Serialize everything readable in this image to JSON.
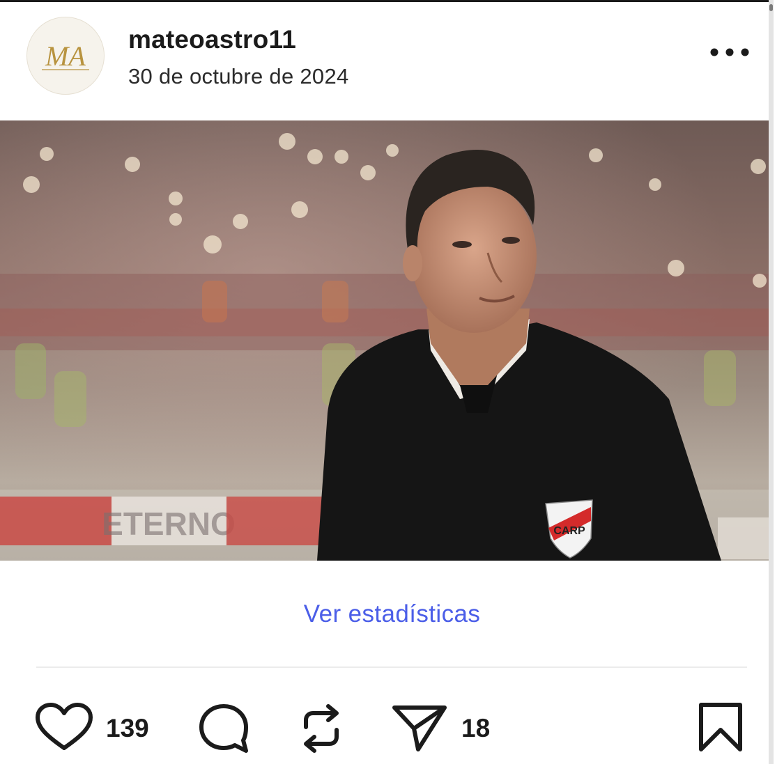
{
  "post": {
    "username": "mateoastro11",
    "date": "30 de octubre de 2024",
    "avatar_monogram": "MA",
    "more_icon": "more-horizontal-icon",
    "image": {
      "subject": "coach in black suit at stadium",
      "banner_text_1": "ETERNO"
    }
  },
  "stats_link": "Ver estadísticas",
  "actions": {
    "likes": "139",
    "shares": "18",
    "like_icon": "heart-icon",
    "comment_icon": "comment-icon",
    "repost_icon": "repost-icon",
    "share_icon": "send-icon",
    "save_icon": "bookmark-icon"
  },
  "colors": {
    "link": "#4b5ee8",
    "text": "#1b1b1b",
    "avatar_gold": "#b8933f"
  }
}
